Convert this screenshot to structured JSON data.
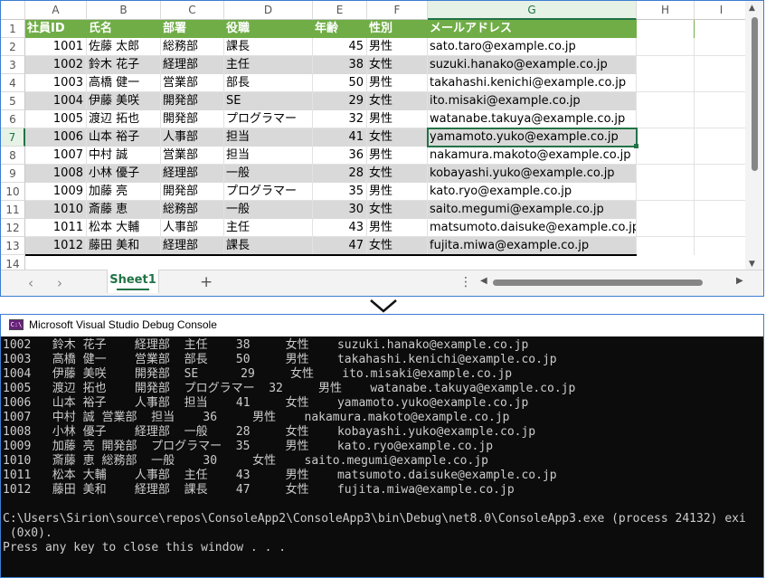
{
  "spreadsheet": {
    "columns": [
      "A",
      "B",
      "C",
      "D",
      "E",
      "F",
      "G",
      "H",
      "I"
    ],
    "selected_column": "G",
    "selected_row": "7",
    "row_numbers": [
      "1",
      "2",
      "3",
      "4",
      "5",
      "6",
      "7",
      "8",
      "9",
      "10",
      "11",
      "12",
      "13",
      "14"
    ],
    "headers": [
      "社員ID",
      "氏名",
      "部署",
      "役職",
      "年齢",
      "性別",
      "メールアドレス"
    ],
    "rows": [
      [
        "1001",
        "佐藤 太郎",
        "総務部",
        "課長",
        "45",
        "男性",
        "sato.taro@example.co.jp"
      ],
      [
        "1002",
        "鈴木 花子",
        "経理部",
        "主任",
        "38",
        "女性",
        "suzuki.hanako@example.co.jp"
      ],
      [
        "1003",
        "高橋 健一",
        "営業部",
        "部長",
        "50",
        "男性",
        "takahashi.kenichi@example.co.jp"
      ],
      [
        "1004",
        "伊藤 美咲",
        "開発部",
        "SE",
        "29",
        "女性",
        "ito.misaki@example.co.jp"
      ],
      [
        "1005",
        "渡辺 拓也",
        "開発部",
        "プログラマー",
        "32",
        "男性",
        "watanabe.takuya@example.co.jp"
      ],
      [
        "1006",
        "山本 裕子",
        "人事部",
        "担当",
        "41",
        "女性",
        "yamamoto.yuko@example.co.jp"
      ],
      [
        "1007",
        "中村 誠",
        "営業部",
        "担当",
        "36",
        "男性",
        "nakamura.makoto@example.co.jp"
      ],
      [
        "1008",
        "小林 優子",
        "経理部",
        "一般",
        "28",
        "女性",
        "kobayashi.yuko@example.co.jp"
      ],
      [
        "1009",
        "加藤 亮",
        "開発部",
        "プログラマー",
        "35",
        "男性",
        "kato.ryo@example.co.jp"
      ],
      [
        "1010",
        "斎藤 恵",
        "総務部",
        "一般",
        "30",
        "女性",
        "saito.megumi@example.co.jp"
      ],
      [
        "1011",
        "松本 大輔",
        "人事部",
        "主任",
        "43",
        "男性",
        "matsumoto.daisuke@example.co.jp"
      ],
      [
        "1012",
        "藤田 美和",
        "経理部",
        "課長",
        "47",
        "女性",
        "fujita.miwa@example.co.jp"
      ]
    ],
    "sheet_tab": "Sheet1",
    "add_sheet_label": "+",
    "more_label": "⋮",
    "nav_prev": "‹",
    "nav_next": "›",
    "header_color": "#70ad47",
    "band_color": "#d9d9d9",
    "accent_color": "#217346"
  },
  "console": {
    "title": "Microsoft Visual Studio Debug Console",
    "icon_label": "C:\\",
    "lines": [
      "1002   鈴木 花子    経理部  主任    38     女性    suzuki.hanako@example.co.jp",
      "1003   高橋 健一    営業部  部長    50     男性    takahashi.kenichi@example.co.jp",
      "1004   伊藤 美咲    開発部  SE      29     女性    ito.misaki@example.co.jp",
      "1005   渡辺 拓也    開発部  プログラマー  32     男性    watanabe.takuya@example.co.jp",
      "1006   山本 裕子    人事部  担当    41     女性    yamamoto.yuko@example.co.jp",
      "1007   中村 誠 営業部  担当    36     男性    nakamura.makoto@example.co.jp",
      "1008   小林 優子    経理部  一般    28     女性    kobayashi.yuko@example.co.jp",
      "1009   加藤 亮 開発部  プログラマー  35     男性    kato.ryo@example.co.jp",
      "1010   斎藤 恵 総務部  一般    30     女性    saito.megumi@example.co.jp",
      "1011   松本 大輔    人事部  主任    43     男性    matsumoto.daisuke@example.co.jp",
      "1012   藤田 美和    経理部  課長    47     女性    fujita.miwa@example.co.jp",
      "",
      "C:\\Users\\Sirion\\source\\repos\\ConsoleApp2\\ConsoleApp3\\bin\\Debug\\net8.0\\ConsoleApp3.exe (process 24132) exi",
      " (0x0).",
      "Press any key to close this window . . ."
    ]
  }
}
